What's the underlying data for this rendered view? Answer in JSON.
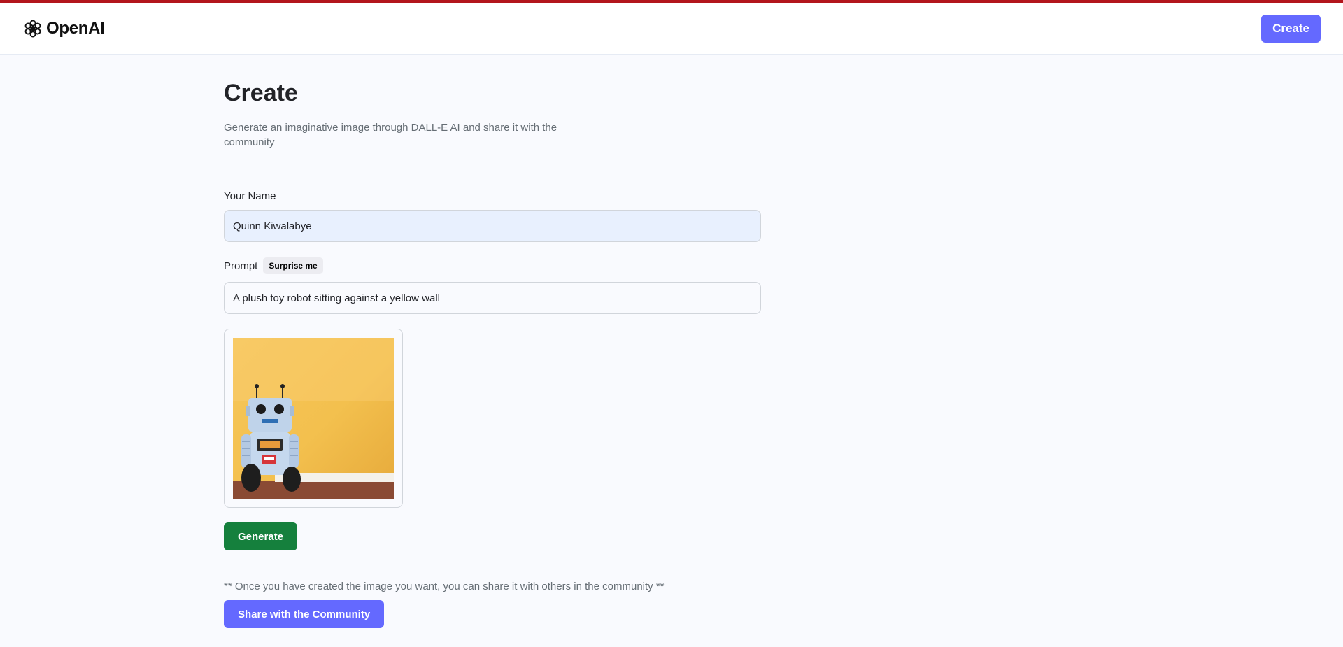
{
  "header": {
    "logo_text": "OpenAI",
    "logo_icon": "openai-logo-icon",
    "create_label": "Create"
  },
  "page": {
    "title": "Create",
    "description": "Generate an imaginative image through DALL-E AI and share it with the community"
  },
  "form": {
    "name_label": "Your Name",
    "name_value": "Quinn Kiwalabye",
    "prompt_label": "Prompt",
    "surprise_label": "Surprise me",
    "prompt_value": "A plush toy robot sitting against a yellow wall",
    "generate_label": "Generate"
  },
  "share": {
    "note": "** Once you have created the image you want, you can share it with others in the community **",
    "button_label": "Share with the Community"
  },
  "colors": {
    "accent": "#6469ff",
    "generate": "#15803d",
    "top_bar": "#b3151c",
    "background": "#f9fafe"
  }
}
